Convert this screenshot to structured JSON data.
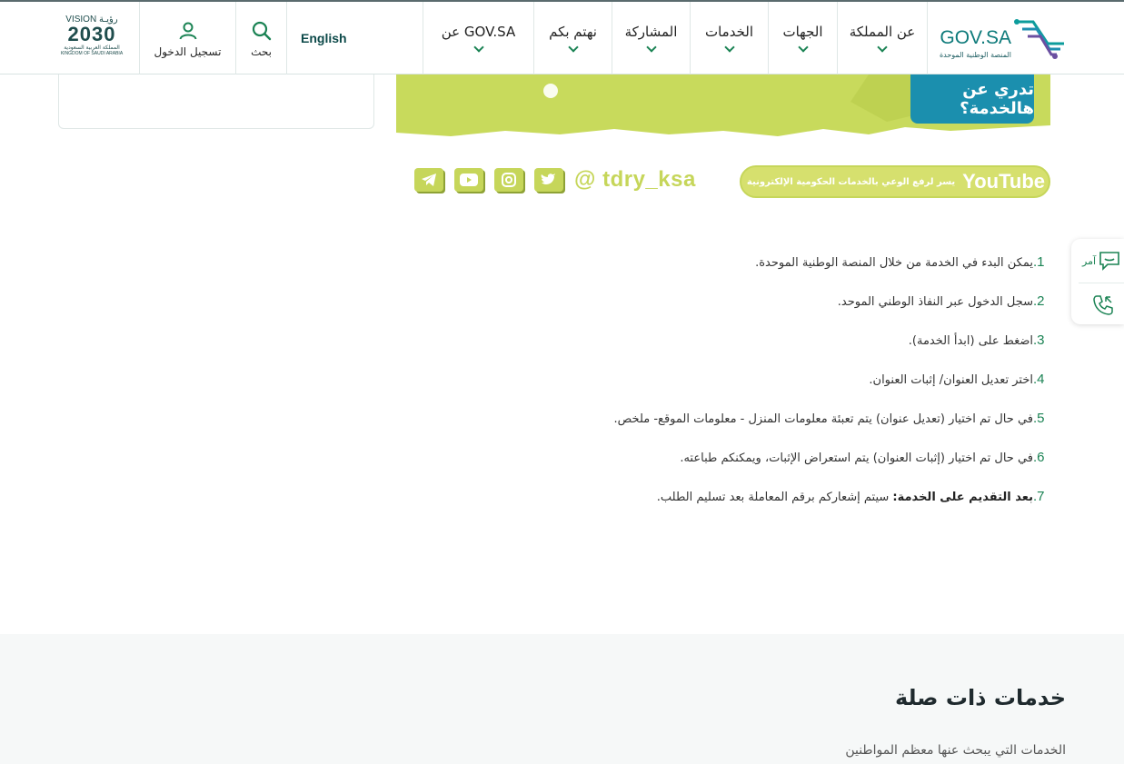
{
  "header": {
    "logo_text": "GOV.SA",
    "logo_sub": "المنصة الوطنية الموحدة",
    "nav": [
      {
        "label": "عن المملكة"
      },
      {
        "label": "الجهات"
      },
      {
        "label": "الخدمات"
      },
      {
        "label": "المشاركة"
      },
      {
        "label": "نهتم بكم"
      },
      {
        "label": "عن GOV.SA"
      }
    ],
    "language": "English",
    "search_label": "بحث",
    "login_label": "تسجيل الدخول",
    "vision_top": "VISION رؤيـة",
    "vision_year": "2030",
    "vision_sub": "المملكة العربية السعودية",
    "vision_sub_en": "KINGDOM OF SAUDI ARABIA"
  },
  "banner": {
    "handle": "@ tdry_ksa",
    "youtube_text": "يسر لرفع الوعي بالخدمات الحكومية الإلكترونية",
    "youtube_logo": "YouTube",
    "badge_text": "تدري عن هالخدمة؟"
  },
  "steps": [
    {
      "num": "1.",
      "text": "يمكن البدء في الخدمة من خلال المنصة الوطنية الموحدة."
    },
    {
      "num": "2.",
      "text": "سجل الدخول عبر النفاذ الوطني الموحد."
    },
    {
      "num": "3.",
      "text": "اضغط على (ابدأ الخدمة)."
    },
    {
      "num": "4.",
      "text": "اختر تعديل العنوان/ إثبات العنوان."
    },
    {
      "num": "5.",
      "text": "في حال تم اختيار (تعديل عنوان) يتم تعبئة معلومات المنزل - معلومات الموقع- ملخص."
    },
    {
      "num": "6.",
      "text": "في حال تم اختيار (إثبات العنوان) يتم استعراض الإثبات، ويمكنكم طباعته."
    },
    {
      "num": "7.",
      "bold": "بعد التقديم على الخدمة:",
      "text": " سيتم إشعاركم برقم المعاملة بعد تسليم الطلب."
    }
  ],
  "widget": {
    "amr_label": "آمر"
  },
  "related": {
    "title": "خدمات ذات صلة",
    "subtitle": "الخدمات التي يبحث عنها معظم المواطنين"
  },
  "colors": {
    "brand_green": "#1b8354",
    "teal": "#0d7a7a",
    "lime": "#c6d65a"
  }
}
